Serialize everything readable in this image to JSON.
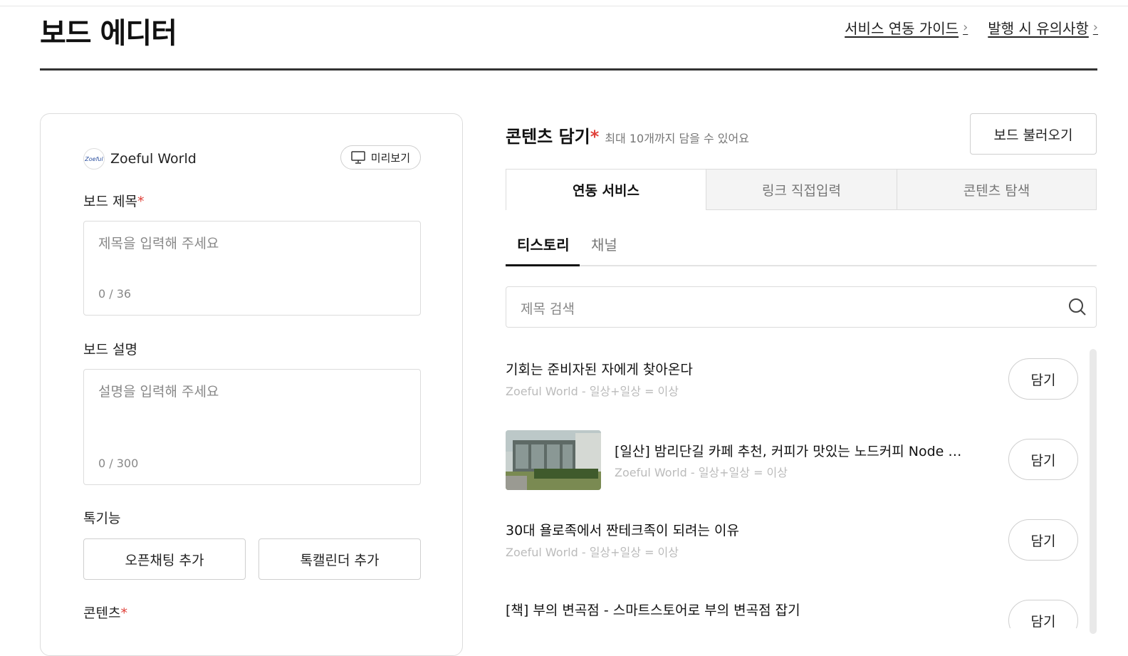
{
  "page": {
    "title": "보드 에디터",
    "links": [
      {
        "label": "서비스 연동 가이드"
      },
      {
        "label": "발행 시 유의사항"
      }
    ]
  },
  "editor": {
    "account_name": "Zoeful World",
    "logo_text": "Zoeful",
    "preview_label": "미리보기",
    "title_label": "보드 제목",
    "title_placeholder": "제목을 입력해 주세요",
    "title_count": "0 / 36",
    "desc_label": "보드 설명",
    "desc_placeholder": "설명을 입력해 주세요",
    "desc_count": "0 / 300",
    "talk_label": "톡기능",
    "open_chat_label": "오픈채팅 추가",
    "talk_calendar_label": "톡캘린더 추가",
    "content_label": "콘텐츠",
    "required_mark": "*"
  },
  "content": {
    "title": "콘텐츠 담기",
    "hint": "최대 10개까지 담을 수 있어요",
    "load_board_label": "보드 불러오기",
    "tabs": [
      {
        "label": "연동 서비스",
        "active": true
      },
      {
        "label": "링크 직접입력",
        "active": false
      },
      {
        "label": "콘텐츠 탐색",
        "active": false
      }
    ],
    "subtabs": [
      {
        "label": "티스토리",
        "active": true
      },
      {
        "label": "채널",
        "active": false
      }
    ],
    "search_placeholder": "제목 검색",
    "add_label": "담기",
    "items": [
      {
        "title": "기회는 준비자된 자에게 찾아온다",
        "meta": "Zoeful World - 일상+일상 = 이상",
        "has_thumb": false
      },
      {
        "title": "[일산] 밤리단길 카페 추천, 커피가 맛있는 노드커피 Node Coffee",
        "meta": "Zoeful World - 일상+일상 = 이상",
        "has_thumb": true
      },
      {
        "title": "30대 욜로족에서 짠테크족이 되려는 이유",
        "meta": "Zoeful World - 일상+일상 = 이상",
        "has_thumb": false
      },
      {
        "title": "[책] 부의 변곡점 - 스마트스토어로 부의 변곡점 잡기",
        "meta": "",
        "has_thumb": false
      }
    ]
  },
  "colors": {
    "accent_required": "#e0413a",
    "border": "#dcdcdc",
    "tab_inactive_bg": "#f4f4f4"
  }
}
